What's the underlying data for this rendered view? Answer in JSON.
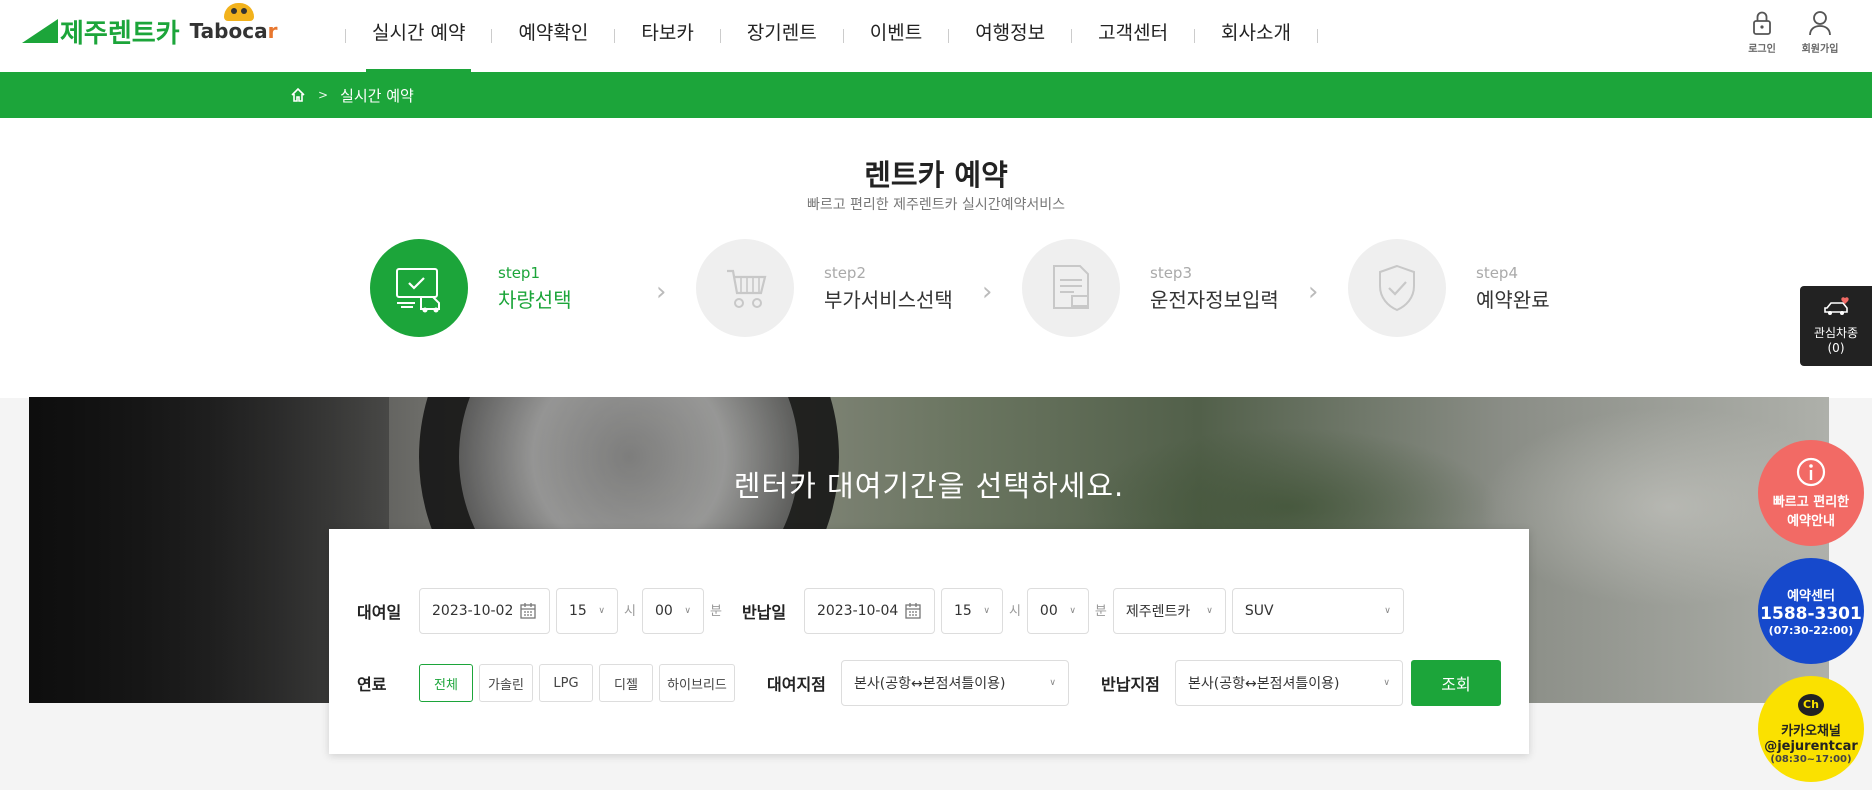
{
  "header": {
    "brand": "제주렌트카",
    "partner_brand_main": "Taboca",
    "partner_brand_end": "r",
    "nav": [
      "실시간 예약",
      "예약확인",
      "타보카",
      "장기렌트",
      "이벤트",
      "여행정보",
      "고객센터",
      "회사소개"
    ],
    "active_nav": 0,
    "util": {
      "login": "로그인",
      "join": "회원가입",
      "login_icon": "lock-icon",
      "join_icon": "user-icon"
    }
  },
  "breadcrumb": {
    "home_icon": "home-icon",
    "current": "실시간 예약"
  },
  "page": {
    "title": "렌트카 예약",
    "subtitle": "빠르고 편리한 제주렌트카 실시간예약서비스"
  },
  "steps": [
    {
      "num": "step1",
      "name": "차량선택",
      "icon": "car-check-icon",
      "active": true
    },
    {
      "num": "step2",
      "name": "부가서비스선택",
      "icon": "stroller-icon",
      "active": false
    },
    {
      "num": "step3",
      "name": "운전자정보입력",
      "icon": "document-icon",
      "active": false
    },
    {
      "num": "step4",
      "name": "예약완료",
      "icon": "shield-check-icon",
      "active": false
    }
  ],
  "banner": {
    "title": "렌터카 대여기간을 선택하세요."
  },
  "search": {
    "rent_label": "대여일",
    "rent_date": "2023-10-02",
    "rent_hour": "15",
    "rent_min": "00",
    "hour_unit": "시",
    "min_unit": "분",
    "return_label": "반납일",
    "return_date": "2023-10-04",
    "return_hour": "15",
    "return_min": "00",
    "company": "제주렌트카",
    "car_type": "SUV",
    "fuel_label": "연료",
    "fuels": [
      "전체",
      "가솔린",
      "LPG",
      "디젤",
      "하이브리드"
    ],
    "fuel_selected": 0,
    "rent_place_label": "대여지점",
    "rent_place": "본사(공항↔본점셔틀이용)",
    "return_place_label": "반납지점",
    "return_place": "본사(공항↔본점셔틀이용)",
    "submit": "조회"
  },
  "side": {
    "favorites": "관심차종",
    "favorites_count": "(0)",
    "guide_line1": "빠르고 편리한",
    "guide_line2": "예약안내",
    "center_label": "예약센터",
    "center_phone": "1588-3301",
    "center_hours": "(07:30-22:00)",
    "kakao_badge": "Ch",
    "kakao_label": "카카오채널",
    "kakao_id": "@jejurentcar",
    "kakao_hours": "(08:30~17:00)"
  },
  "colors": {
    "brand_green": "#1ca53a",
    "fab_red": "#f26a65",
    "fab_blue": "#1649cc",
    "kakao_yellow": "#fae100"
  }
}
